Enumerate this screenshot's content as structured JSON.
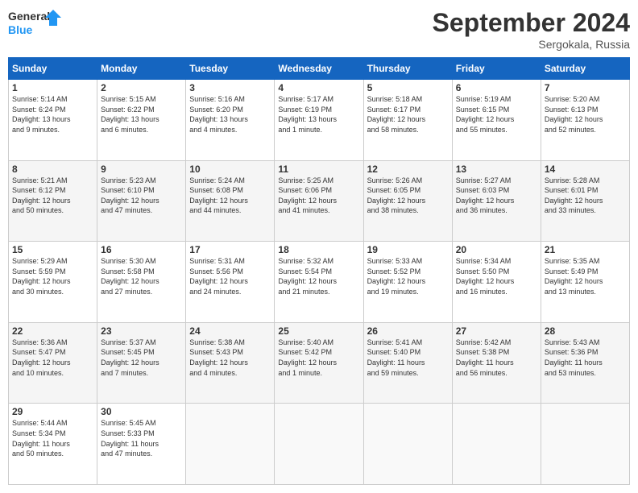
{
  "logo": {
    "line1": "General",
    "line2": "Blue"
  },
  "title": "September 2024",
  "subtitle": "Sergokala, Russia",
  "days_of_week": [
    "Sunday",
    "Monday",
    "Tuesday",
    "Wednesday",
    "Thursday",
    "Friday",
    "Saturday"
  ],
  "weeks": [
    [
      {
        "day": 1,
        "info": "Sunrise: 5:14 AM\nSunset: 6:24 PM\nDaylight: 13 hours\nand 9 minutes."
      },
      {
        "day": 2,
        "info": "Sunrise: 5:15 AM\nSunset: 6:22 PM\nDaylight: 13 hours\nand 6 minutes."
      },
      {
        "day": 3,
        "info": "Sunrise: 5:16 AM\nSunset: 6:20 PM\nDaylight: 13 hours\nand 4 minutes."
      },
      {
        "day": 4,
        "info": "Sunrise: 5:17 AM\nSunset: 6:19 PM\nDaylight: 13 hours\nand 1 minute."
      },
      {
        "day": 5,
        "info": "Sunrise: 5:18 AM\nSunset: 6:17 PM\nDaylight: 12 hours\nand 58 minutes."
      },
      {
        "day": 6,
        "info": "Sunrise: 5:19 AM\nSunset: 6:15 PM\nDaylight: 12 hours\nand 55 minutes."
      },
      {
        "day": 7,
        "info": "Sunrise: 5:20 AM\nSunset: 6:13 PM\nDaylight: 12 hours\nand 52 minutes."
      }
    ],
    [
      {
        "day": 8,
        "info": "Sunrise: 5:21 AM\nSunset: 6:12 PM\nDaylight: 12 hours\nand 50 minutes."
      },
      {
        "day": 9,
        "info": "Sunrise: 5:23 AM\nSunset: 6:10 PM\nDaylight: 12 hours\nand 47 minutes."
      },
      {
        "day": 10,
        "info": "Sunrise: 5:24 AM\nSunset: 6:08 PM\nDaylight: 12 hours\nand 44 minutes."
      },
      {
        "day": 11,
        "info": "Sunrise: 5:25 AM\nSunset: 6:06 PM\nDaylight: 12 hours\nand 41 minutes."
      },
      {
        "day": 12,
        "info": "Sunrise: 5:26 AM\nSunset: 6:05 PM\nDaylight: 12 hours\nand 38 minutes."
      },
      {
        "day": 13,
        "info": "Sunrise: 5:27 AM\nSunset: 6:03 PM\nDaylight: 12 hours\nand 36 minutes."
      },
      {
        "day": 14,
        "info": "Sunrise: 5:28 AM\nSunset: 6:01 PM\nDaylight: 12 hours\nand 33 minutes."
      }
    ],
    [
      {
        "day": 15,
        "info": "Sunrise: 5:29 AM\nSunset: 5:59 PM\nDaylight: 12 hours\nand 30 minutes."
      },
      {
        "day": 16,
        "info": "Sunrise: 5:30 AM\nSunset: 5:58 PM\nDaylight: 12 hours\nand 27 minutes."
      },
      {
        "day": 17,
        "info": "Sunrise: 5:31 AM\nSunset: 5:56 PM\nDaylight: 12 hours\nand 24 minutes."
      },
      {
        "day": 18,
        "info": "Sunrise: 5:32 AM\nSunset: 5:54 PM\nDaylight: 12 hours\nand 21 minutes."
      },
      {
        "day": 19,
        "info": "Sunrise: 5:33 AM\nSunset: 5:52 PM\nDaylight: 12 hours\nand 19 minutes."
      },
      {
        "day": 20,
        "info": "Sunrise: 5:34 AM\nSunset: 5:50 PM\nDaylight: 12 hours\nand 16 minutes."
      },
      {
        "day": 21,
        "info": "Sunrise: 5:35 AM\nSunset: 5:49 PM\nDaylight: 12 hours\nand 13 minutes."
      }
    ],
    [
      {
        "day": 22,
        "info": "Sunrise: 5:36 AM\nSunset: 5:47 PM\nDaylight: 12 hours\nand 10 minutes."
      },
      {
        "day": 23,
        "info": "Sunrise: 5:37 AM\nSunset: 5:45 PM\nDaylight: 12 hours\nand 7 minutes."
      },
      {
        "day": 24,
        "info": "Sunrise: 5:38 AM\nSunset: 5:43 PM\nDaylight: 12 hours\nand 4 minutes."
      },
      {
        "day": 25,
        "info": "Sunrise: 5:40 AM\nSunset: 5:42 PM\nDaylight: 12 hours\nand 1 minute."
      },
      {
        "day": 26,
        "info": "Sunrise: 5:41 AM\nSunset: 5:40 PM\nDaylight: 11 hours\nand 59 minutes."
      },
      {
        "day": 27,
        "info": "Sunrise: 5:42 AM\nSunset: 5:38 PM\nDaylight: 11 hours\nand 56 minutes."
      },
      {
        "day": 28,
        "info": "Sunrise: 5:43 AM\nSunset: 5:36 PM\nDaylight: 11 hours\nand 53 minutes."
      }
    ],
    [
      {
        "day": 29,
        "info": "Sunrise: 5:44 AM\nSunset: 5:34 PM\nDaylight: 11 hours\nand 50 minutes."
      },
      {
        "day": 30,
        "info": "Sunrise: 5:45 AM\nSunset: 5:33 PM\nDaylight: 11 hours\nand 47 minutes."
      },
      null,
      null,
      null,
      null,
      null
    ]
  ]
}
